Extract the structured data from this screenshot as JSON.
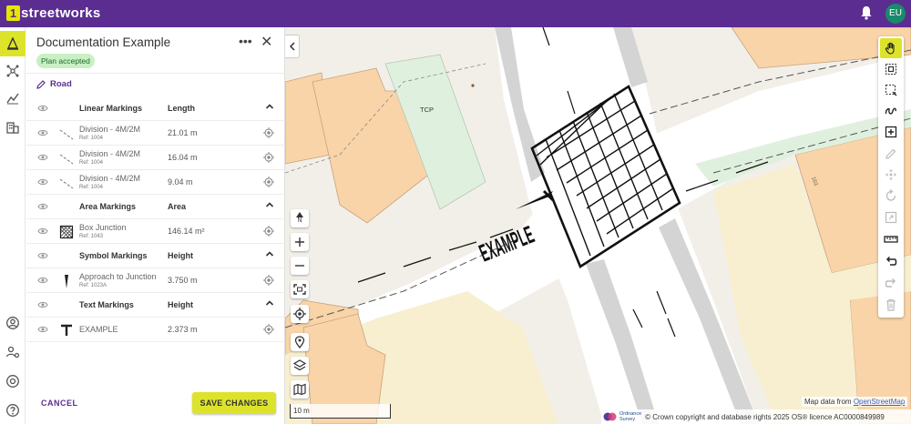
{
  "app": {
    "logo_digit": "1",
    "logo_name": "streetworks",
    "avatar_initials": "EU",
    "brand_color": "#5c2d91",
    "accent_color": "#dde32b"
  },
  "panel": {
    "title": "Documentation Example",
    "status_badge": "Plan accepted",
    "section_label": "Road",
    "groups": [
      {
        "name": "Linear Markings",
        "column": "Length",
        "items": [
          {
            "name": "Division - 4M/2M",
            "ref": "Ref: 1004",
            "value": "21.01 m"
          },
          {
            "name": "Division - 4M/2M",
            "ref": "Ref: 1004",
            "value": "16.04 m"
          },
          {
            "name": "Division - 4M/2M",
            "ref": "Ref: 1004",
            "value": "9.04 m"
          }
        ]
      },
      {
        "name": "Area Markings",
        "column": "Area",
        "items": [
          {
            "name": "Box Junction",
            "ref": "Ref: 1043",
            "value": "146.14 m²"
          }
        ]
      },
      {
        "name": "Symbol Markings",
        "column": "Height",
        "items": [
          {
            "name": "Approach to Junction",
            "ref": "Ref: 1023A",
            "value": "3.750 m"
          }
        ]
      },
      {
        "name": "Text Markings",
        "column": "Height",
        "items": [
          {
            "name": "EXAMPLE",
            "value": "2.373 m"
          }
        ]
      }
    ],
    "cancel_label": "CANCEL",
    "save_label": "SAVE CHANGES"
  },
  "map": {
    "north_label": "N",
    "building_label_tcp": "TCP",
    "building_number": "163",
    "road_text": "EXAMPLE",
    "scale_label": "10 m",
    "attribution_prefix": "Map data from ",
    "attribution_link": "OpenStreetMap",
    "os_line1": "Ordnance",
    "os_line2": "Survey",
    "copyright": "© Crown copyright and database rights 2025 OS® licence AC0000849989"
  }
}
